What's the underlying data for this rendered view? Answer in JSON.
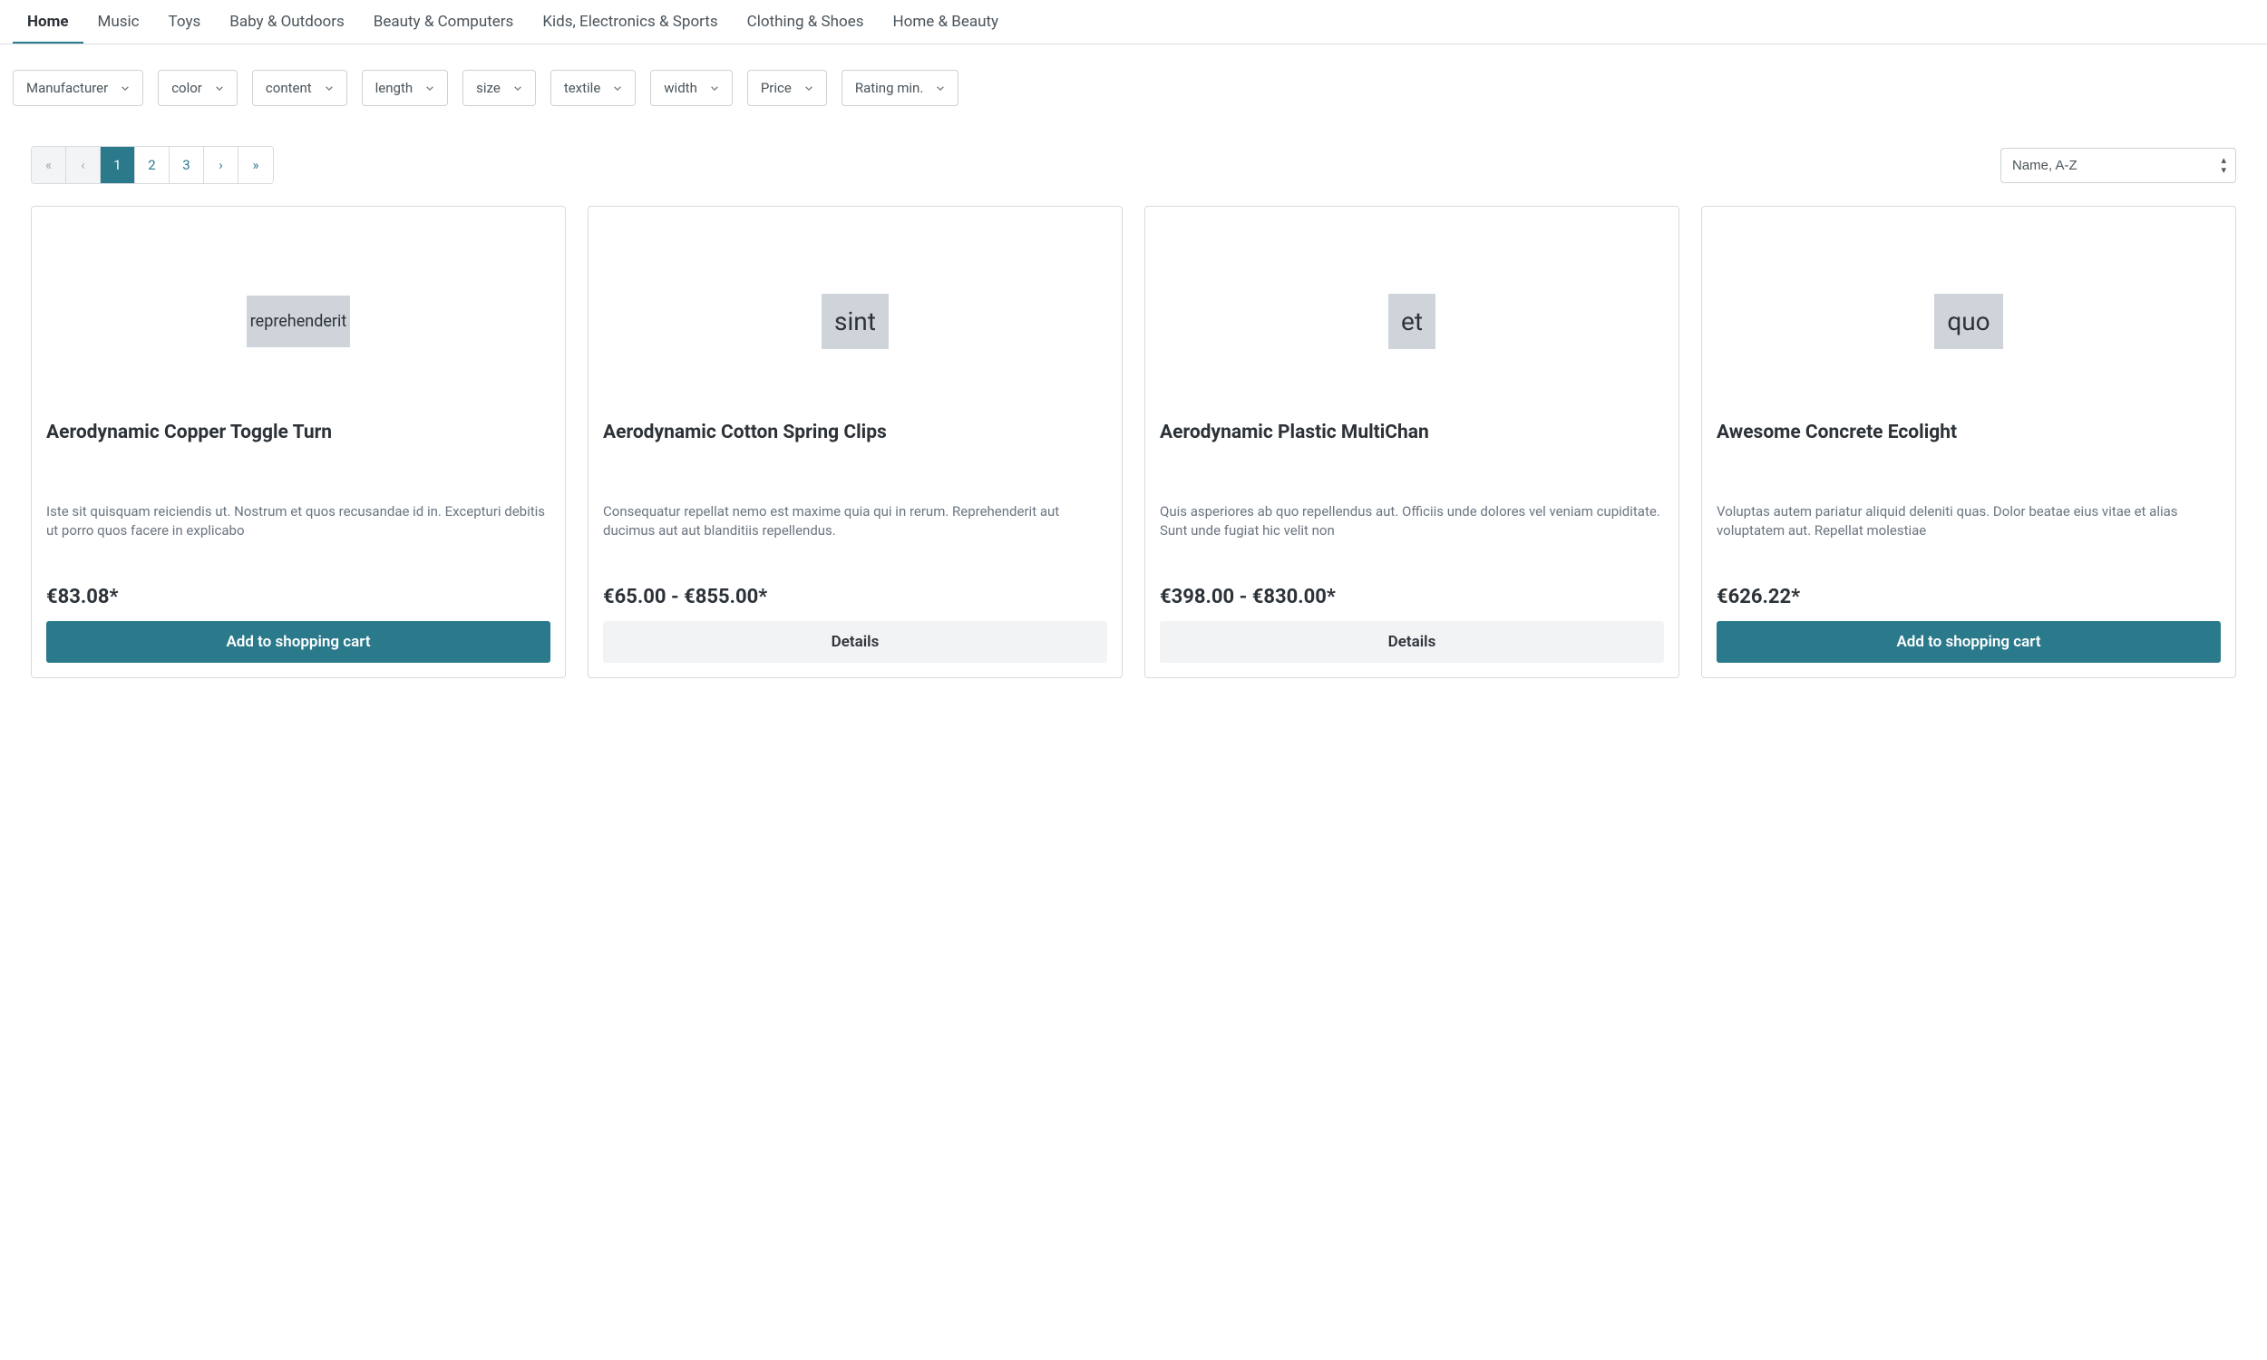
{
  "nav": {
    "items": [
      {
        "label": "Home",
        "active": true
      },
      {
        "label": "Music",
        "active": false
      },
      {
        "label": "Toys",
        "active": false
      },
      {
        "label": "Baby & Outdoors",
        "active": false
      },
      {
        "label": "Beauty & Computers",
        "active": false
      },
      {
        "label": "Kids, Electronics & Sports",
        "active": false
      },
      {
        "label": "Clothing & Shoes",
        "active": false
      },
      {
        "label": "Home & Beauty",
        "active": false
      }
    ]
  },
  "filters": [
    {
      "label": "Manufacturer"
    },
    {
      "label": "color"
    },
    {
      "label": "content"
    },
    {
      "label": "length"
    },
    {
      "label": "size"
    },
    {
      "label": "textile"
    },
    {
      "label": "width"
    },
    {
      "label": "Price"
    },
    {
      "label": "Rating min."
    }
  ],
  "pagination": {
    "first": "«",
    "prev": "‹",
    "next": "›",
    "last": "»",
    "pages": [
      "1",
      "2",
      "3"
    ],
    "active_index": 0
  },
  "sort": {
    "selected": "Name, A-Z"
  },
  "products": [
    {
      "image_text": "reprehenderit",
      "image_small": true,
      "title": "Aerodynamic Copper Toggle Turn",
      "desc": "Iste sit quisquam reiciendis ut. Nostrum et quos recusandae id in. Excepturi debitis ut porro quos facere in explicabo",
      "price": "€83.08*",
      "action_label": "Add to shopping cart",
      "primary": true
    },
    {
      "image_text": "sint",
      "image_small": false,
      "title": "Aerodynamic Cotton Spring Clips",
      "desc": "Consequatur repellat nemo est maxime quia qui in rerum. Reprehenderit aut ducimus aut aut blanditiis repellendus.",
      "price": "€65.00 - €855.00*",
      "action_label": "Details",
      "primary": false
    },
    {
      "image_text": "et",
      "image_small": false,
      "title": "Aerodynamic Plastic MultiChan",
      "desc": "Quis asperiores ab quo repellendus aut. Officiis unde dolores vel veniam cupiditate. Sunt unde fugiat hic velit non",
      "price": "€398.00 - €830.00*",
      "action_label": "Details",
      "primary": false
    },
    {
      "image_text": "quo",
      "image_small": false,
      "title": "Awesome Concrete Ecolight",
      "desc": "Voluptas autem pariatur aliquid deleniti quas. Dolor beatae eius vitae et alias voluptatem aut. Repellat molestiae",
      "price": "€626.22*",
      "action_label": "Add to shopping cart",
      "primary": true
    }
  ],
  "colors": {
    "accent": "#2b7a8c"
  }
}
